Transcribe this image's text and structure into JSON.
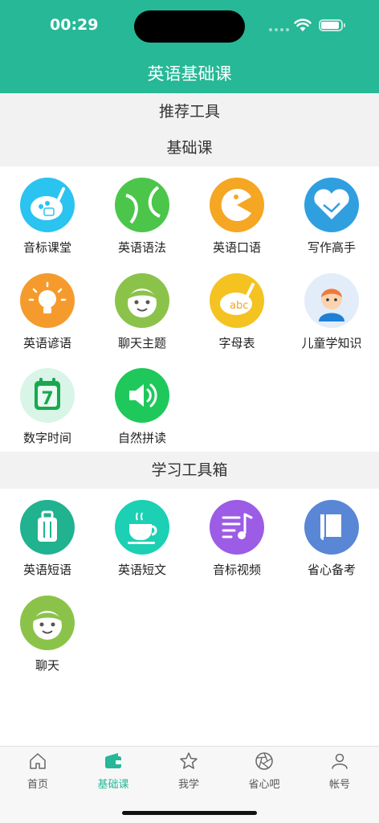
{
  "status": {
    "time": "00:29"
  },
  "nav": {
    "title": "英语基础课"
  },
  "sections": {
    "recommended": "推荐工具",
    "basic": "基础课",
    "toolbox": "学习工具箱"
  },
  "basic_items": [
    {
      "label": "音标课堂",
      "icon": "palette-icon",
      "color": "#2bc3f0"
    },
    {
      "label": "英语语法",
      "icon": "tennis-ball-icon",
      "color": "#4cc64a"
    },
    {
      "label": "英语口语",
      "icon": "pacman-icon",
      "color": "#f5a623"
    },
    {
      "label": "写作高手",
      "icon": "handshake-icon",
      "color": "#2f9fe0"
    },
    {
      "label": "英语谚语",
      "icon": "lightbulb-icon",
      "color": "#f59b2d"
    },
    {
      "label": "聊天主题",
      "icon": "face-icon",
      "color": "#8bc34a"
    },
    {
      "label": "字母表",
      "icon": "abc-palette-icon",
      "color": "#f4c321"
    },
    {
      "label": "儿童学知识",
      "icon": "child-avatar-icon",
      "color": "#e2edf9"
    },
    {
      "label": "数字时间",
      "icon": "calendar-seven-icon",
      "color": "#d8f5e8"
    },
    {
      "label": "自然拼读",
      "icon": "speaker-icon",
      "color": "#1ec85a"
    }
  ],
  "toolbox_items": [
    {
      "label": "英语短语",
      "icon": "suitcase-icon",
      "color": "#21b28f"
    },
    {
      "label": "英语短文",
      "icon": "teacup-icon",
      "color": "#1cd0b4"
    },
    {
      "label": "音标视频",
      "icon": "music-list-icon",
      "color": "#9c5ce6"
    },
    {
      "label": "省心备考",
      "icon": "book-icon",
      "color": "#5a86d6"
    },
    {
      "label": "聊天",
      "icon": "face-icon",
      "color": "#8bc34a"
    }
  ],
  "tabs": [
    {
      "label": "首页",
      "icon": "home-icon"
    },
    {
      "label": "基础课",
      "icon": "wallet-icon",
      "active": true
    },
    {
      "label": "我学",
      "icon": "star-icon"
    },
    {
      "label": "省心吧",
      "icon": "aperture-icon"
    },
    {
      "label": "帐号",
      "icon": "person-icon"
    }
  ],
  "colors": {
    "accent": "#26b897",
    "band": "#f2f2f2"
  }
}
